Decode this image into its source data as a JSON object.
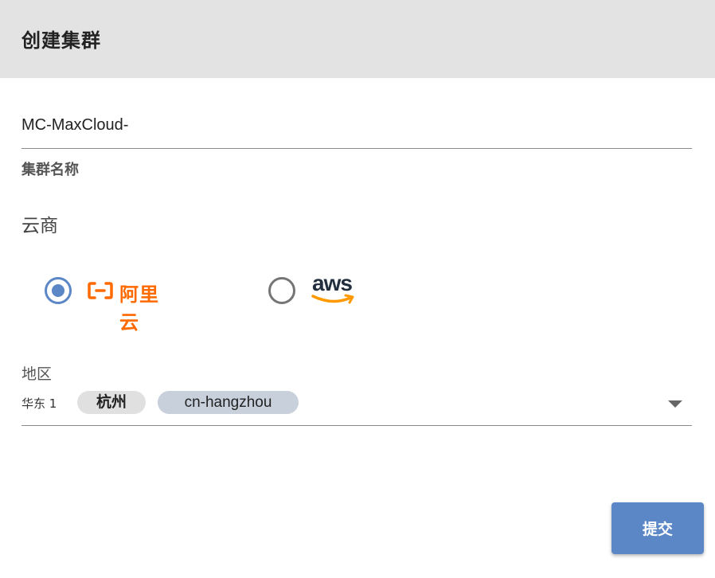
{
  "dialog": {
    "title": "创建集群",
    "submit_label": "提交"
  },
  "cluster_name": {
    "value": "MC-MaxCloud-",
    "helper": "集群名称"
  },
  "cloud_provider": {
    "label": "云商",
    "options": [
      {
        "name": "aliyun",
        "logo_text": "阿里云",
        "selected": true,
        "logo_color": "#ff6a00"
      },
      {
        "name": "aws",
        "logo_text": "aws",
        "selected": false,
        "logo_color": "#232f3e"
      }
    ],
    "accent_color": "#5b87c6"
  },
  "region": {
    "label": "地区",
    "prefix": "华东 1",
    "city": "杭州",
    "code": "cn-hangzhou"
  },
  "colors": {
    "header_bg": "#e3e3e3",
    "primary": "#5b87c6",
    "aws_smile": "#ff9900"
  }
}
